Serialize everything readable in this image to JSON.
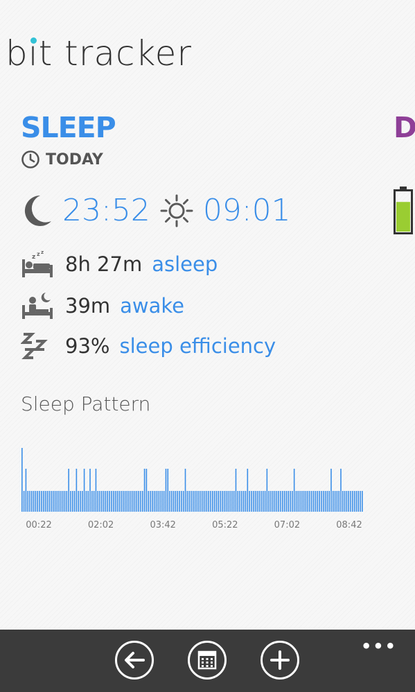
{
  "app": {
    "title_prefix": "b",
    "title_i": "i",
    "title_rest": "t tracker"
  },
  "section": {
    "title": "SLEEP",
    "next_title_peek": "D",
    "period_label": "TODAY"
  },
  "times": {
    "bedtime": "23:52",
    "wake_time": "09:01",
    "bedtime_icon": "moon-icon",
    "wake_icon": "sun-icon"
  },
  "stats": [
    {
      "icon": "sleeping-bed-icon",
      "value": "8h 27m",
      "label": "asleep"
    },
    {
      "icon": "awake-bed-icon",
      "value": "39m",
      "label": "awake"
    },
    {
      "icon": "zzz-icon",
      "value": "93%",
      "label": "sleep efficiency"
    }
  ],
  "battery": {
    "level": 0.75,
    "color": "#9acd32"
  },
  "pattern": {
    "title": "Sleep Pattern"
  },
  "chart_data": {
    "type": "bar",
    "title": "Sleep Pattern",
    "xlabel": "",
    "ylabel": "",
    "tick_labels": [
      "00:22",
      "02:02",
      "03:42",
      "05:22",
      "07:02",
      "08:42"
    ],
    "levels": [
      "asleep",
      "restless",
      "awake"
    ],
    "minute_count": 527,
    "events": [
      {
        "minute": 0,
        "level": "awake"
      },
      {
        "minute": 1,
        "level": "awake"
      },
      {
        "minute": 6,
        "level": "restless"
      },
      {
        "minute": 74,
        "level": "restless"
      },
      {
        "minute": 84,
        "level": "restless"
      },
      {
        "minute": 97,
        "level": "restless"
      },
      {
        "minute": 105,
        "level": "restless"
      },
      {
        "minute": 115,
        "level": "restless"
      },
      {
        "minute": 190,
        "level": "restless"
      },
      {
        "minute": 191,
        "level": "restless"
      },
      {
        "minute": 192,
        "level": "restless"
      },
      {
        "minute": 223,
        "level": "restless"
      },
      {
        "minute": 224,
        "level": "restless"
      },
      {
        "minute": 225,
        "level": "restless"
      },
      {
        "minute": 252,
        "level": "restless"
      },
      {
        "minute": 332,
        "level": "restless"
      },
      {
        "minute": 350,
        "level": "restless"
      },
      {
        "minute": 380,
        "level": "restless"
      },
      {
        "minute": 420,
        "level": "restless"
      },
      {
        "minute": 477,
        "level": "restless"
      },
      {
        "minute": 493,
        "level": "restless"
      }
    ],
    "colors": {
      "bars": "#3a8ee8"
    }
  },
  "appbar": {
    "back_icon": "back-arrow-icon",
    "calendar_icon": "calendar-icon",
    "add_icon": "plus-icon",
    "more_label": "•••"
  }
}
